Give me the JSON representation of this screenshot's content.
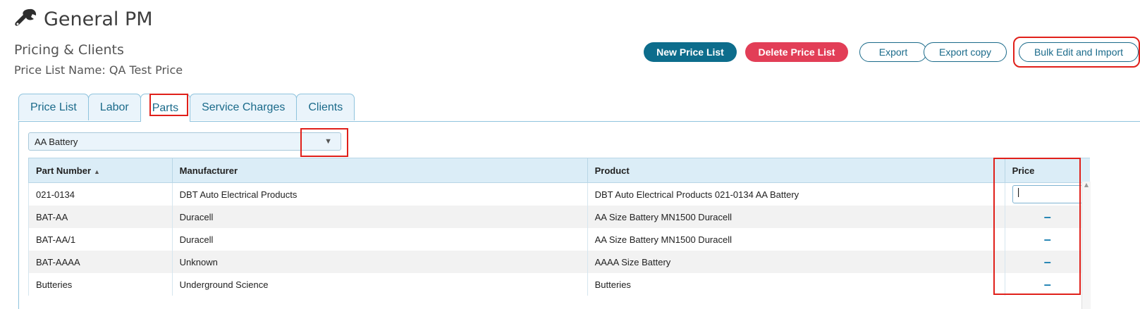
{
  "header": {
    "app_title": "General PM",
    "subtitle": "Pricing & Clients",
    "price_list_name": "Price List Name: QA Test Price"
  },
  "toolbar": {
    "new_price_list": "New Price List",
    "delete_price_list": "Delete Price List",
    "export": "Export",
    "export_copy": "Export copy",
    "bulk_edit": "Bulk Edit and Import"
  },
  "tabs": [
    {
      "label": "Price List"
    },
    {
      "label": "Labor"
    },
    {
      "label": "Parts",
      "active": true
    },
    {
      "label": "Service Charges"
    },
    {
      "label": "Clients"
    }
  ],
  "filter": {
    "selected": "AA Battery"
  },
  "table": {
    "columns": [
      "Part Number",
      "Manufacturer",
      "Product",
      "Price"
    ],
    "rows": [
      {
        "part": "021-0134",
        "manufacturer": "DBT Auto Electrical Products",
        "product": "DBT Auto Electrical Products 021-0134 AA Battery",
        "price": "|"
      },
      {
        "part": "BAT-AA",
        "manufacturer": "Duracell",
        "product": "AA Size Battery MN1500 Duracell",
        "price": "–"
      },
      {
        "part": "BAT-AA/1",
        "manufacturer": "Duracell",
        "product": "AA Size Battery MN1500 Duracell",
        "price": "–"
      },
      {
        "part": "BAT-AAAA",
        "manufacturer": "Unknown",
        "product": "AAAA Size Battery",
        "price": "–"
      },
      {
        "part": "Butteries",
        "manufacturer": "Underground Science",
        "product": "Butteries",
        "price": "–"
      }
    ]
  },
  "colors": {
    "primary": "#0d6d8c",
    "danger": "#e23e57",
    "highlight": "#e0201a"
  },
  "icons": {
    "title_icon": "wrench-icon",
    "sort_icon": "sort-ascending-icon",
    "dropdown_icon": "chevron-down-icon"
  }
}
